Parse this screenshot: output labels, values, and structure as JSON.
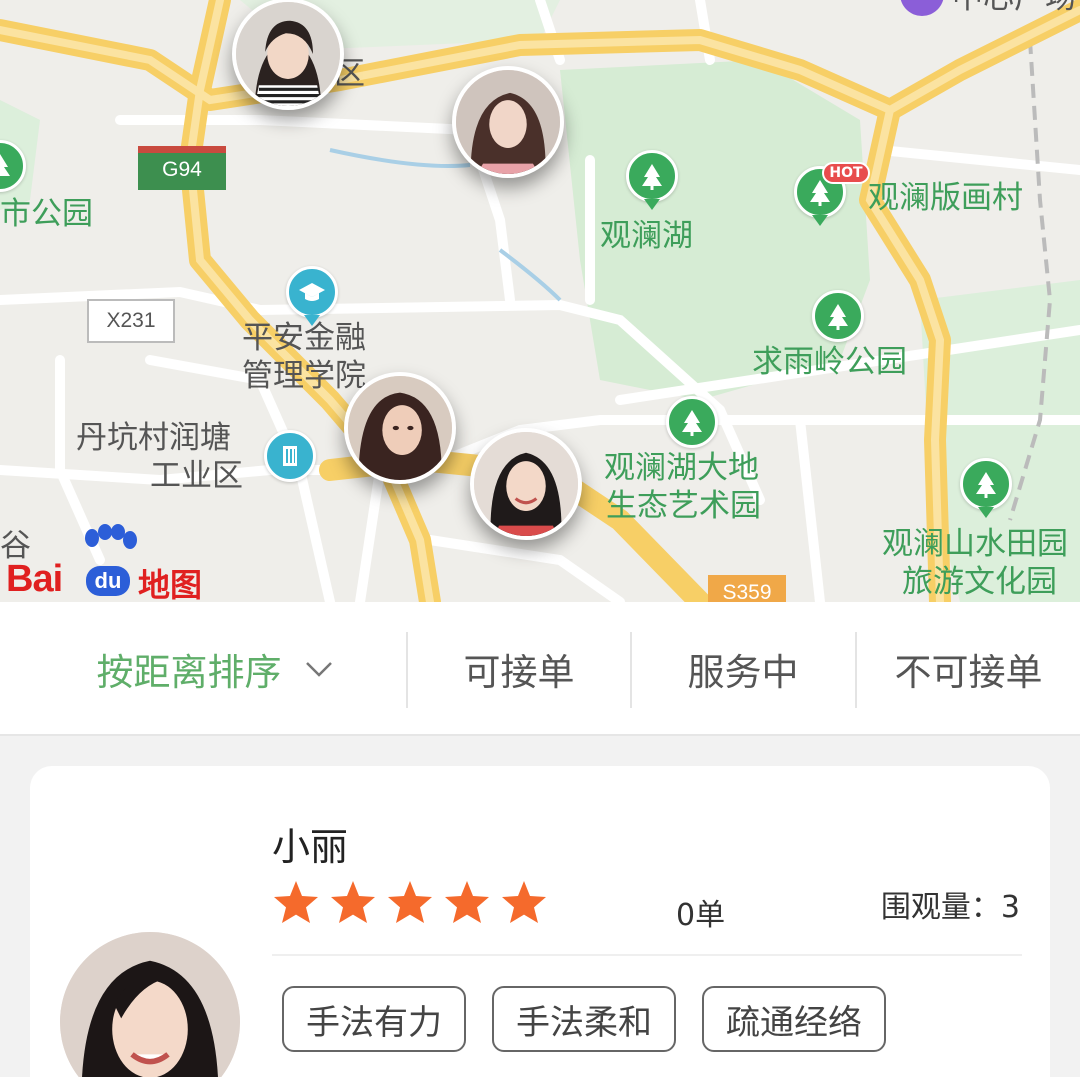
{
  "map": {
    "labels": {
      "shi_gongyuan": "市公园",
      "qu": "区",
      "zhongxin": "中心广场",
      "guanlan_lake": "观澜湖",
      "guanlan_printing": "观澜版画村",
      "pingan_1": "平安金融",
      "pingan_2": "管理学院",
      "qiuyuling": "求雨岭公园",
      "dankeng_1": "丹坑村润塘",
      "dankeng_2": "工业区",
      "art_park_1": "观澜湖大地",
      "art_park_2": "生态艺术园",
      "shuitian_1": "观澜山水田园",
      "shuitian_2": "旅游文化园",
      "gu": "谷"
    },
    "roads": {
      "g94": "G94",
      "x231": "X231",
      "s359": "S359"
    },
    "hot_badge": "HOT",
    "logo": {
      "bai": "Bai",
      "du": "du",
      "ditu": "地图"
    },
    "colors": {
      "poi_green": "#3aaa5c",
      "poi_blue": "#39b3cf",
      "road_yellow": "#f7cf66"
    }
  },
  "filter": {
    "sort_label": "按距离排序",
    "tabs": [
      "可接单",
      "服务中",
      "不可接单"
    ],
    "active_color": "#5fae69"
  },
  "card": {
    "name": "小丽",
    "rating": 5,
    "orders": "0单",
    "views": "围观量：3",
    "tags": [
      "手法有力",
      "手法柔和",
      "疏通经络"
    ]
  }
}
